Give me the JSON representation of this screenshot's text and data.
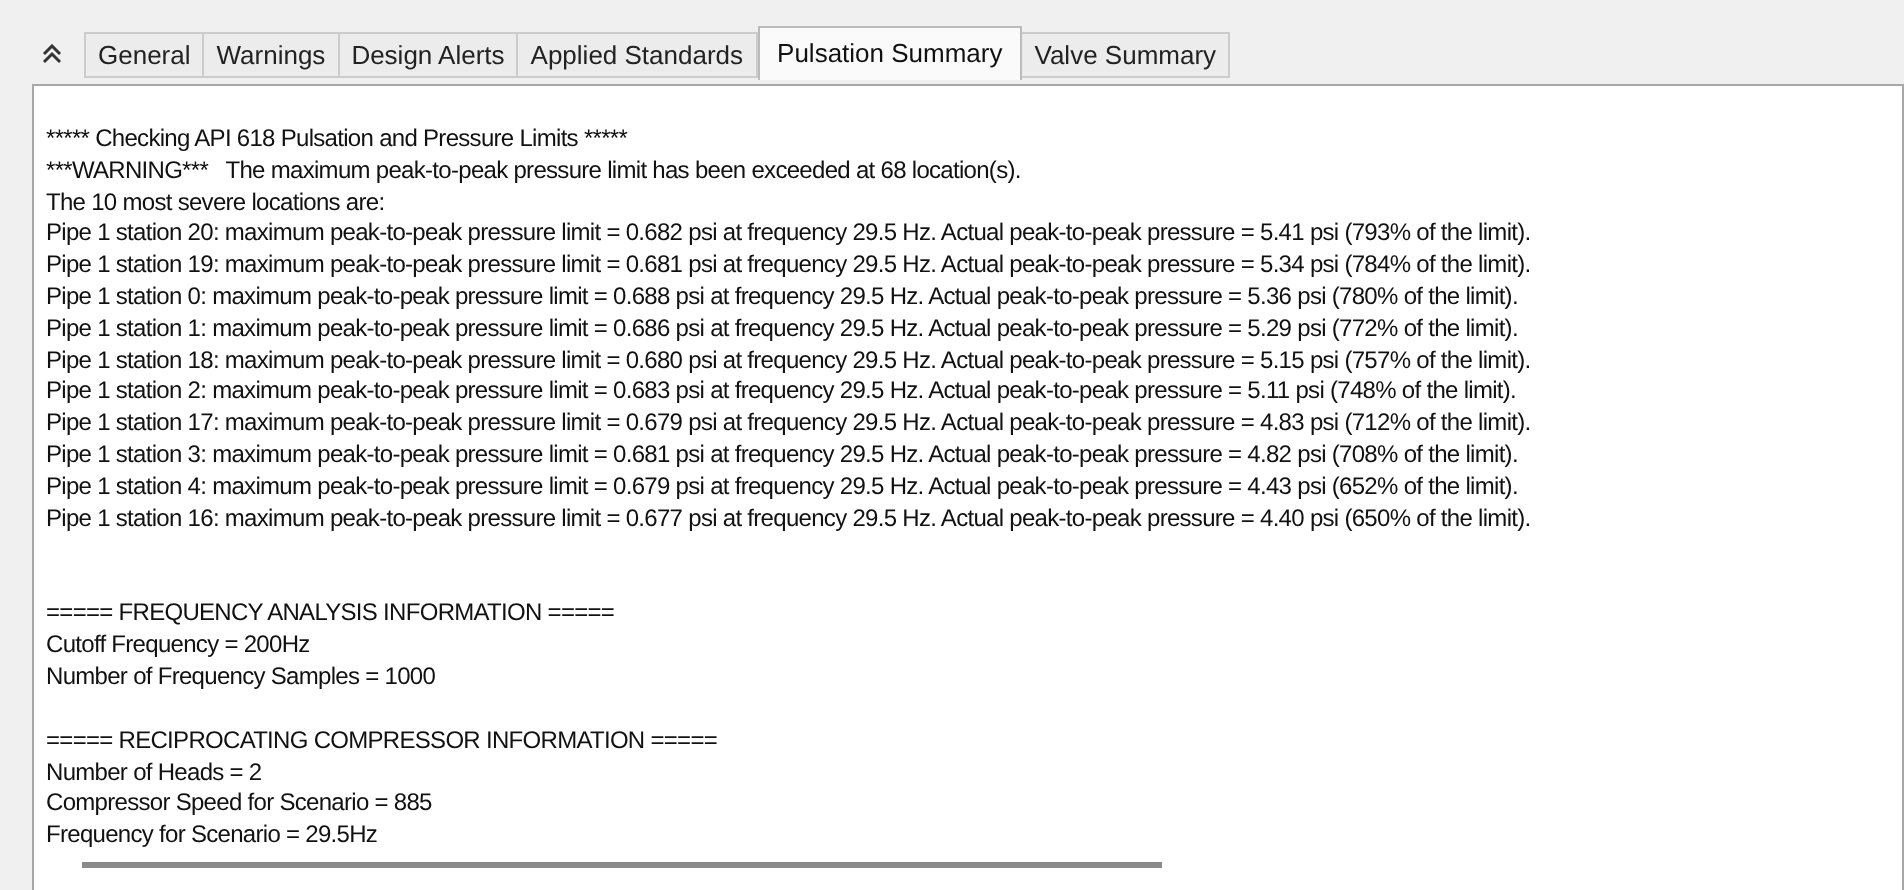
{
  "tabs": [
    {
      "label": "General",
      "selected": false
    },
    {
      "label": "Warnings",
      "selected": false
    },
    {
      "label": "Design Alerts",
      "selected": false
    },
    {
      "label": "Applied Standards",
      "selected": false
    },
    {
      "label": "Pulsation Summary",
      "selected": true
    },
    {
      "label": "Valve Summary",
      "selected": false
    }
  ],
  "output": {
    "sections": [
      {
        "lines": [
          "***** Checking API 618 Pulsation and Pressure Limits *****",
          "***WARNING***   The maximum peak-to-peak pressure limit has been exceeded at 68 location(s).",
          "The 10 most severe locations are:",
          "Pipe 1 station 20: maximum peak-to-peak pressure limit = 0.682 psi at frequency 29.5 Hz. Actual peak-to-peak pressure = 5.41 psi (793% of the limit).",
          "Pipe 1 station 19: maximum peak-to-peak pressure limit = 0.681 psi at frequency 29.5 Hz. Actual peak-to-peak pressure = 5.34 psi (784% of the limit).",
          "Pipe 1 station 0: maximum peak-to-peak pressure limit = 0.688 psi at frequency 29.5 Hz. Actual peak-to-peak pressure = 5.36 psi (780% of the limit).",
          "Pipe 1 station 1: maximum peak-to-peak pressure limit = 0.686 psi at frequency 29.5 Hz. Actual peak-to-peak pressure = 5.29 psi (772% of the limit).",
          "Pipe 1 station 18: maximum peak-to-peak pressure limit = 0.680 psi at frequency 29.5 Hz. Actual peak-to-peak pressure = 5.15 psi (757% of the limit).",
          "Pipe 1 station 2: maximum peak-to-peak pressure limit = 0.683 psi at frequency 29.5 Hz. Actual peak-to-peak pressure = 5.11 psi (748% of the limit).",
          "Pipe 1 station 17: maximum peak-to-peak pressure limit = 0.679 psi at frequency 29.5 Hz. Actual peak-to-peak pressure = 4.83 psi (712% of the limit).",
          "Pipe 1 station 3: maximum peak-to-peak pressure limit = 0.681 psi at frequency 29.5 Hz. Actual peak-to-peak pressure = 4.82 psi (708% of the limit).",
          "Pipe 1 station 4: maximum peak-to-peak pressure limit = 0.679 psi at frequency 29.5 Hz. Actual peak-to-peak pressure = 4.43 psi (652% of the limit).",
          "Pipe 1 station 16: maximum peak-to-peak pressure limit = 0.677 psi at frequency 29.5 Hz. Actual peak-to-peak pressure = 4.40 psi (650% of the limit)."
        ]
      },
      {
        "lines": [
          "===== FREQUENCY ANALYSIS INFORMATION =====",
          "Cutoff Frequency = 200Hz",
          "Number of Frequency Samples = 1000"
        ]
      },
      {
        "lines": [
          "===== RECIPROCATING COMPRESSOR INFORMATION =====",
          "Number of Heads = 2",
          "Compressor Speed for Scenario = 885",
          "Frequency for Scenario = 29.5Hz"
        ]
      }
    ]
  }
}
